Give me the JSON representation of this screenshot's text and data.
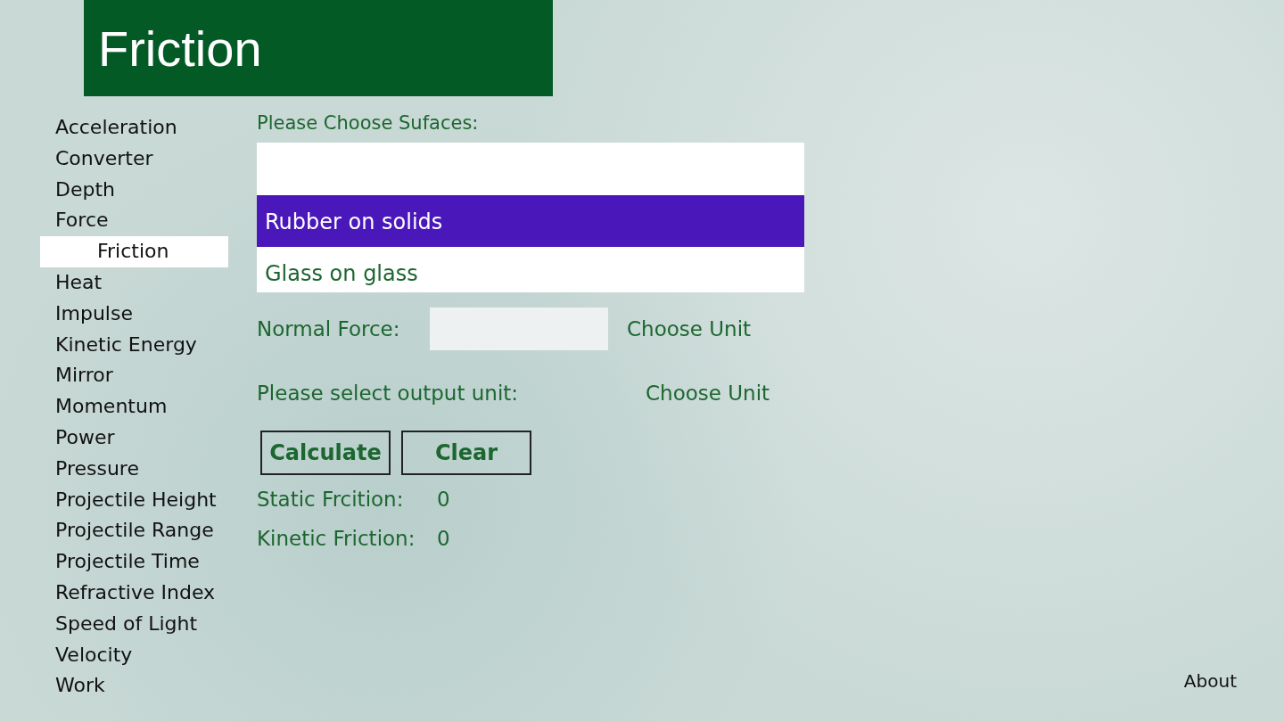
{
  "header": {
    "title": "Friction"
  },
  "sidebar": {
    "items": [
      {
        "label": "Acceleration",
        "selected": false
      },
      {
        "label": "Converter",
        "selected": false
      },
      {
        "label": "Depth",
        "selected": false
      },
      {
        "label": "Force",
        "selected": false
      },
      {
        "label": "Friction",
        "selected": true
      },
      {
        "label": "Heat",
        "selected": false
      },
      {
        "label": "Impulse",
        "selected": false
      },
      {
        "label": "Kinetic Energy",
        "selected": false
      },
      {
        "label": "Mirror",
        "selected": false
      },
      {
        "label": "Momentum",
        "selected": false
      },
      {
        "label": "Power",
        "selected": false
      },
      {
        "label": "Pressure",
        "selected": false
      },
      {
        "label": "Projectile Height",
        "selected": false
      },
      {
        "label": "Projectile Range",
        "selected": false
      },
      {
        "label": "Projectile Time",
        "selected": false
      },
      {
        "label": "Refractive Index",
        "selected": false
      },
      {
        "label": "Speed of Light",
        "selected": false
      },
      {
        "label": "Velocity",
        "selected": false
      },
      {
        "label": "Work",
        "selected": false
      }
    ]
  },
  "surfaces": {
    "label": "Please Choose Sufaces:",
    "options": [
      {
        "label": "Rubber on solids",
        "selected": true
      },
      {
        "label": "Glass on glass",
        "selected": false
      }
    ]
  },
  "normal_force": {
    "label": "Normal Force:",
    "unit": "Choose Unit"
  },
  "output_unit": {
    "label": "Please select output unit:",
    "unit": "Choose Unit"
  },
  "buttons": [
    "Calculate",
    "Clear"
  ],
  "results": [
    {
      "label": "Static Frcition:",
      "value": "0"
    },
    {
      "label": "Kinetic Friction:",
      "value": "0"
    }
  ],
  "footer": {
    "link": "About"
  }
}
